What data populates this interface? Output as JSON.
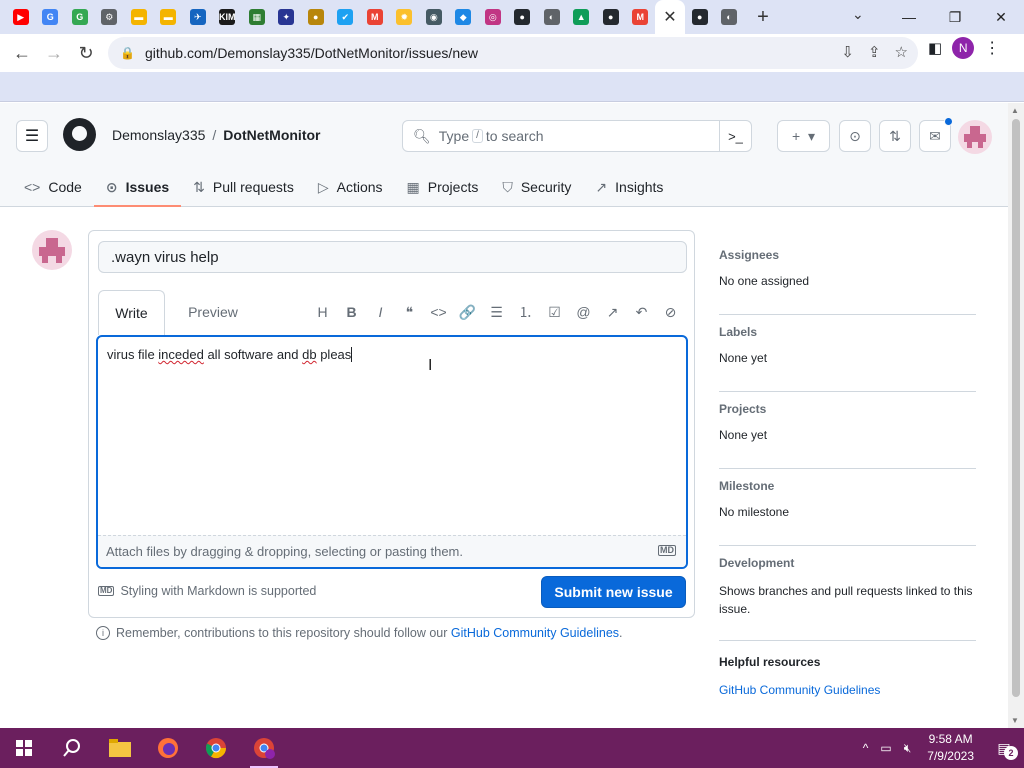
{
  "browser": {
    "tab_favicons": [
      {
        "name": "youtube-icon",
        "color": "#ff0000",
        "glyph": "▶"
      },
      {
        "name": "google-icon",
        "color": "#4285f4",
        "glyph": "G"
      },
      {
        "name": "google-green-icon",
        "color": "#34a853",
        "glyph": "G"
      },
      {
        "name": "settings-icon",
        "color": "#5f6368",
        "glyph": "⚙"
      },
      {
        "name": "folder-icon",
        "color": "#f4b400",
        "glyph": "▬"
      },
      {
        "name": "folder-icon",
        "color": "#f4b400",
        "glyph": "▬"
      },
      {
        "name": "bird-icon",
        "color": "#1565c0",
        "glyph": "✈"
      },
      {
        "name": "kim-icon",
        "color": "#1b1b1b",
        "glyph": "KIM"
      },
      {
        "name": "qr-icon",
        "color": "#2e7d32",
        "glyph": "▦"
      },
      {
        "name": "puzzle-icon",
        "color": "#283593",
        "glyph": "✦"
      },
      {
        "name": "gold-icon",
        "color": "#b8860b",
        "glyph": "●"
      },
      {
        "name": "twitter-icon",
        "color": "#1da1f2",
        "glyph": "✔"
      },
      {
        "name": "gmail-icon",
        "color": "#ea4335",
        "glyph": "M"
      },
      {
        "name": "bulb-icon",
        "color": "#fbc02d",
        "glyph": "✹"
      },
      {
        "name": "app-icon",
        "color": "#455a64",
        "glyph": "◉"
      },
      {
        "name": "sonic-icon",
        "color": "#1e88e5",
        "glyph": "◆"
      },
      {
        "name": "instagram-icon",
        "color": "#c13584",
        "glyph": "◎"
      },
      {
        "name": "github-icon",
        "color": "#24292f",
        "glyph": "●"
      },
      {
        "name": "chrome-icon",
        "color": "#5f6368",
        "glyph": "◐"
      },
      {
        "name": "drive-icon",
        "color": "#0f9d58",
        "glyph": "▲"
      },
      {
        "name": "github-icon",
        "color": "#24292f",
        "glyph": "●"
      },
      {
        "name": "gmail-icon",
        "color": "#ea4335",
        "glyph": "M"
      }
    ],
    "active_tab_favicon": "github-icon",
    "trailing_tabs": [
      {
        "name": "github-icon",
        "color": "#24292f",
        "glyph": "●"
      },
      {
        "name": "chrome-icon",
        "color": "#5f6368",
        "glyph": "◐"
      }
    ],
    "close_glyph": "✕",
    "new_tab_glyph": "+",
    "dropdown_glyph": "⌄",
    "window_controls": {
      "minimize": "—",
      "maximize": "❐",
      "close": "✕"
    },
    "url": "github.com/Demonslay335/DotNetMonitor/issues/new",
    "profile_initial": "N"
  },
  "github": {
    "owner": "Demonslay335",
    "repo": "DotNetMonitor",
    "search": {
      "prefix": "Type",
      "key": "/",
      "suffix": "to search"
    },
    "nav": [
      {
        "icon": "<>",
        "label": "Code"
      },
      {
        "icon": "⊙",
        "label": "Issues"
      },
      {
        "icon": "⇅",
        "label": "Pull requests"
      },
      {
        "icon": "▷",
        "label": "Actions"
      },
      {
        "icon": "▦",
        "label": "Projects"
      },
      {
        "icon": "⛉",
        "label": "Security"
      },
      {
        "icon": "↗",
        "label": "Insights"
      }
    ],
    "active_nav": "Issues"
  },
  "issue_form": {
    "title_value": ".wayn virus help",
    "tabs": {
      "write": "Write",
      "preview": "Preview"
    },
    "toolbar": [
      "H",
      "B",
      "I",
      "❝",
      "<>",
      "🔗",
      "☰",
      "⒈",
      "☑",
      "@",
      "↗",
      "↶",
      "⊘"
    ],
    "body_parts": [
      {
        "text": "virus file ",
        "squiggle": false
      },
      {
        "text": "inceded",
        "squiggle": true
      },
      {
        "text": " all software and ",
        "squiggle": false
      },
      {
        "text": "db",
        "squiggle": true
      },
      {
        "text": " pleas",
        "squiggle": false
      }
    ],
    "attach_text": "Attach files by dragging & dropping, selecting or pasting them.",
    "markdown_badge": "MD",
    "markdown_note": "Styling with Markdown is supported",
    "submit_label": "Submit new issue",
    "remember_prefix": "Remember, contributions to this repository should follow our",
    "remember_link": "GitHub Community Guidelines",
    "remember_suffix": "."
  },
  "sidebar": {
    "assignees": {
      "heading": "Assignees",
      "value": "No one assigned"
    },
    "labels": {
      "heading": "Labels",
      "value": "None yet"
    },
    "projects": {
      "heading": "Projects",
      "value": "None yet"
    },
    "milestone": {
      "heading": "Milestone",
      "value": "No milestone"
    },
    "development": {
      "heading": "Development",
      "value": "Shows branches and pull requests linked to this issue."
    },
    "helpful": {
      "heading": "Helpful resources",
      "link": "GitHub Community Guidelines"
    }
  },
  "taskbar": {
    "time": "9:58 AM",
    "date": "7/9/2023",
    "notification_count": "2"
  }
}
